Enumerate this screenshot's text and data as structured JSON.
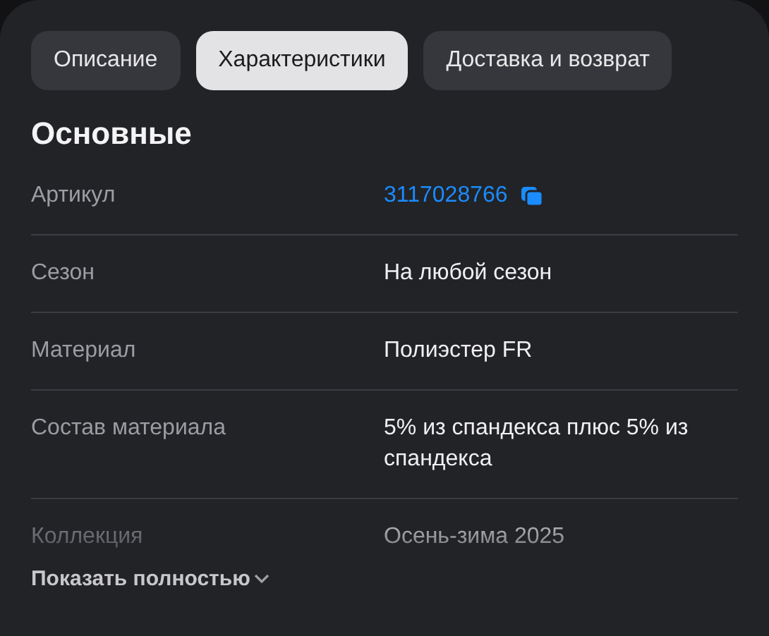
{
  "tabs": [
    {
      "label": "Описание",
      "selected": false
    },
    {
      "label": "Характеристики",
      "selected": true
    },
    {
      "label": "Доставка и возврат",
      "selected": false
    }
  ],
  "section": {
    "title": "Основные"
  },
  "rows": [
    {
      "label": "Артикул",
      "value": "3117028766",
      "kind": "link"
    },
    {
      "label": "Сезон",
      "value": "На любой сезон",
      "kind": "text"
    },
    {
      "label": "Материал",
      "value": "Полиэстер FR",
      "kind": "text"
    },
    {
      "label": "Состав материала",
      "value": "5% из спандекса плюс 5% из спандекса",
      "kind": "text"
    },
    {
      "label": "Коллекция",
      "value": "Осень-зима 2025",
      "kind": "text"
    }
  ],
  "show_more": {
    "label": "Показать полностью"
  }
}
